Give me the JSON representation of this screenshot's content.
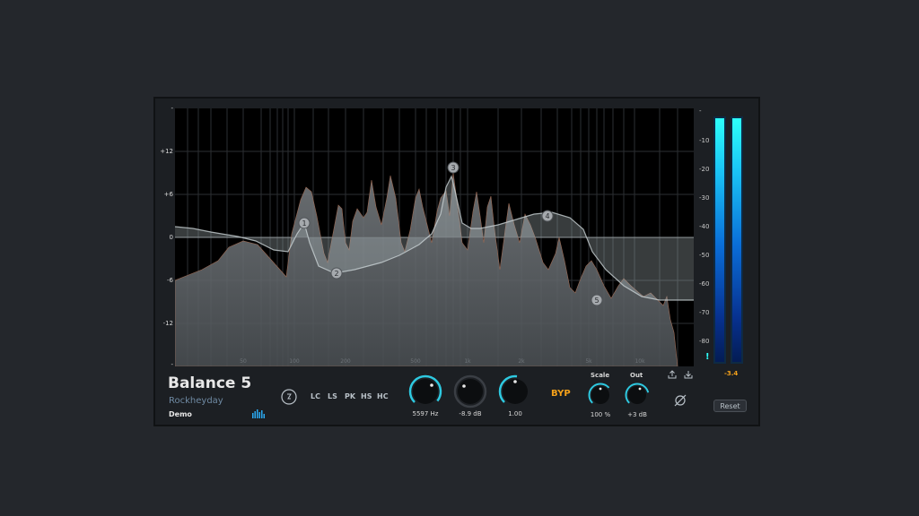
{
  "plugin": {
    "name": "Balance 5",
    "vendor": "Rockheyday",
    "license": "Demo",
    "graph": {
      "db_labels": [
        "-",
        "+12",
        "+6",
        "0",
        "-6",
        "-12",
        "-"
      ],
      "freq_labels": [
        "50",
        "100",
        "200",
        "500",
        "1k",
        "2k",
        "5k",
        "10k"
      ],
      "nodes": [
        "1",
        "2",
        "3",
        "4",
        "5"
      ]
    },
    "filter_types": [
      "LC",
      "LS",
      "PK",
      "HS",
      "HC"
    ],
    "knobs": {
      "frequency": "5597 Hz",
      "gain": "-8.9 dB",
      "q": "1.00",
      "scale_title": "Scale",
      "scale": "100 %",
      "out_title": "Out",
      "out": "+3 dB"
    },
    "bypass_label": "BYP",
    "reset_label": "Reset",
    "meter": {
      "labels": [
        "-",
        "-10",
        "-20",
        "-30",
        "-40",
        "-50",
        "-60",
        "-70",
        "-80"
      ],
      "clip_indicator": "!",
      "readout": "-3.4"
    },
    "colors": {
      "accent_knob": "#2ec9e0",
      "bypass": "#f5a11a",
      "readout": "#f5a11a",
      "meter_top": "#2dfffa",
      "meter_bottom": "#041c54"
    },
    "icons": [
      "power-icon",
      "spectrum-icon",
      "export-icon",
      "import-icon",
      "phase-invert-icon"
    ]
  }
}
